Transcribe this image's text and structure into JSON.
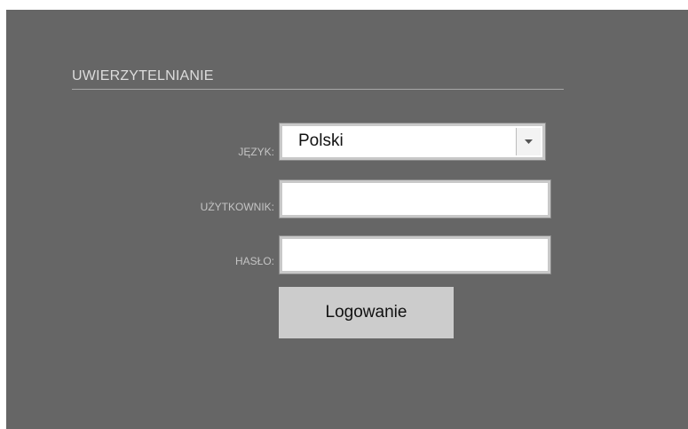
{
  "auth": {
    "heading": "UWIERZYTELNIANIE",
    "language": {
      "label": "JĘZYK:",
      "selected": "Polski"
    },
    "user": {
      "label": "UŻYTKOWNIK:",
      "value": ""
    },
    "password": {
      "label": "HASŁO:",
      "value": ""
    },
    "login_button": "Logowanie"
  },
  "colors": {
    "panel_background": "#666666",
    "heading_text": "#dcdcdc",
    "label_text": "#c4c4c4",
    "button_background": "#cccccc",
    "input_border": "#c8c8c8"
  },
  "icons": {
    "dropdown": "chevron-down-icon"
  }
}
